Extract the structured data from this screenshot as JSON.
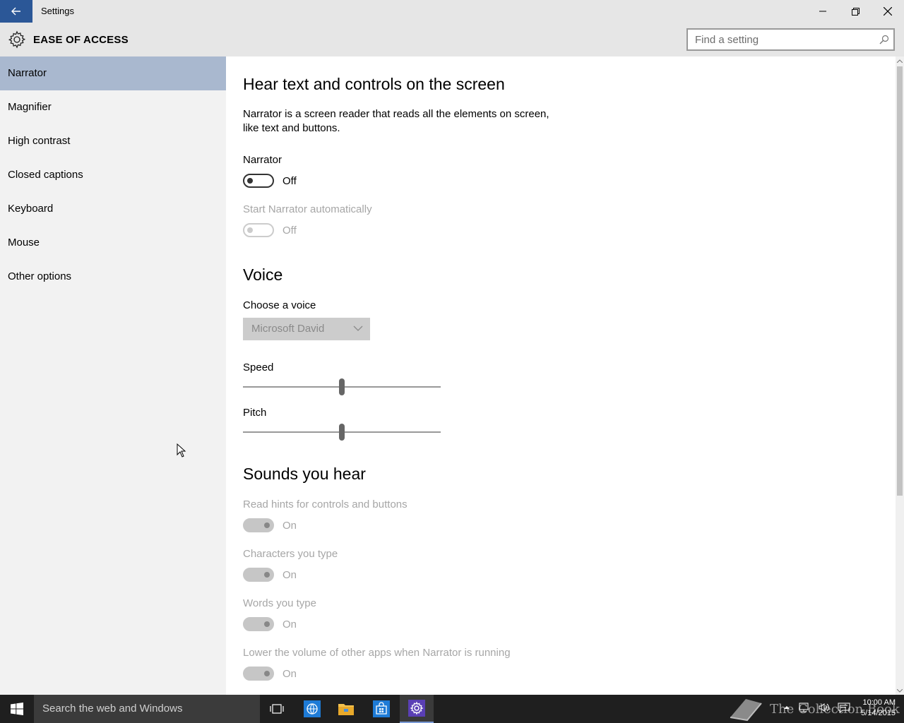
{
  "window": {
    "title": "Settings"
  },
  "header": {
    "section_title": "EASE OF ACCESS",
    "search_placeholder": "Find a setting"
  },
  "sidebar": {
    "items": [
      {
        "label": "Narrator",
        "selected": true
      },
      {
        "label": "Magnifier",
        "selected": false
      },
      {
        "label": "High contrast",
        "selected": false
      },
      {
        "label": "Closed captions",
        "selected": false
      },
      {
        "label": "Keyboard",
        "selected": false
      },
      {
        "label": "Mouse",
        "selected": false
      },
      {
        "label": "Other options",
        "selected": false
      }
    ]
  },
  "content": {
    "heading": "Hear text and controls on the screen",
    "description": "Narrator is a screen reader that reads all the elements on screen, like text and buttons.",
    "narrator": {
      "label": "Narrator",
      "state": "Off"
    },
    "start_auto": {
      "label": "Start Narrator automatically",
      "state": "Off"
    },
    "voice": {
      "heading": "Voice",
      "choose_label": "Choose a voice",
      "selected_voice": "Microsoft David",
      "speed_label": "Speed",
      "speed_value": 0.5,
      "pitch_label": "Pitch",
      "pitch_value": 0.5
    },
    "sounds": {
      "heading": "Sounds you hear",
      "items": [
        {
          "label": "Read hints for controls and buttons",
          "state": "On"
        },
        {
          "label": "Characters you type",
          "state": "On"
        },
        {
          "label": "Words you type",
          "state": "On"
        },
        {
          "label": "Lower the volume of other apps when Narrator is running",
          "state": "On"
        }
      ]
    }
  },
  "taskbar": {
    "search_text": "Search the web and Windows",
    "watermark": "The Collection Book",
    "time": "10:00 AM",
    "date": "5/14/2015"
  },
  "colors": {
    "accent": "#2b5797",
    "sidebar_selected": "#a9b8cf",
    "chrome": "#e6e6e6",
    "taskbar": "#1f1f1f"
  }
}
